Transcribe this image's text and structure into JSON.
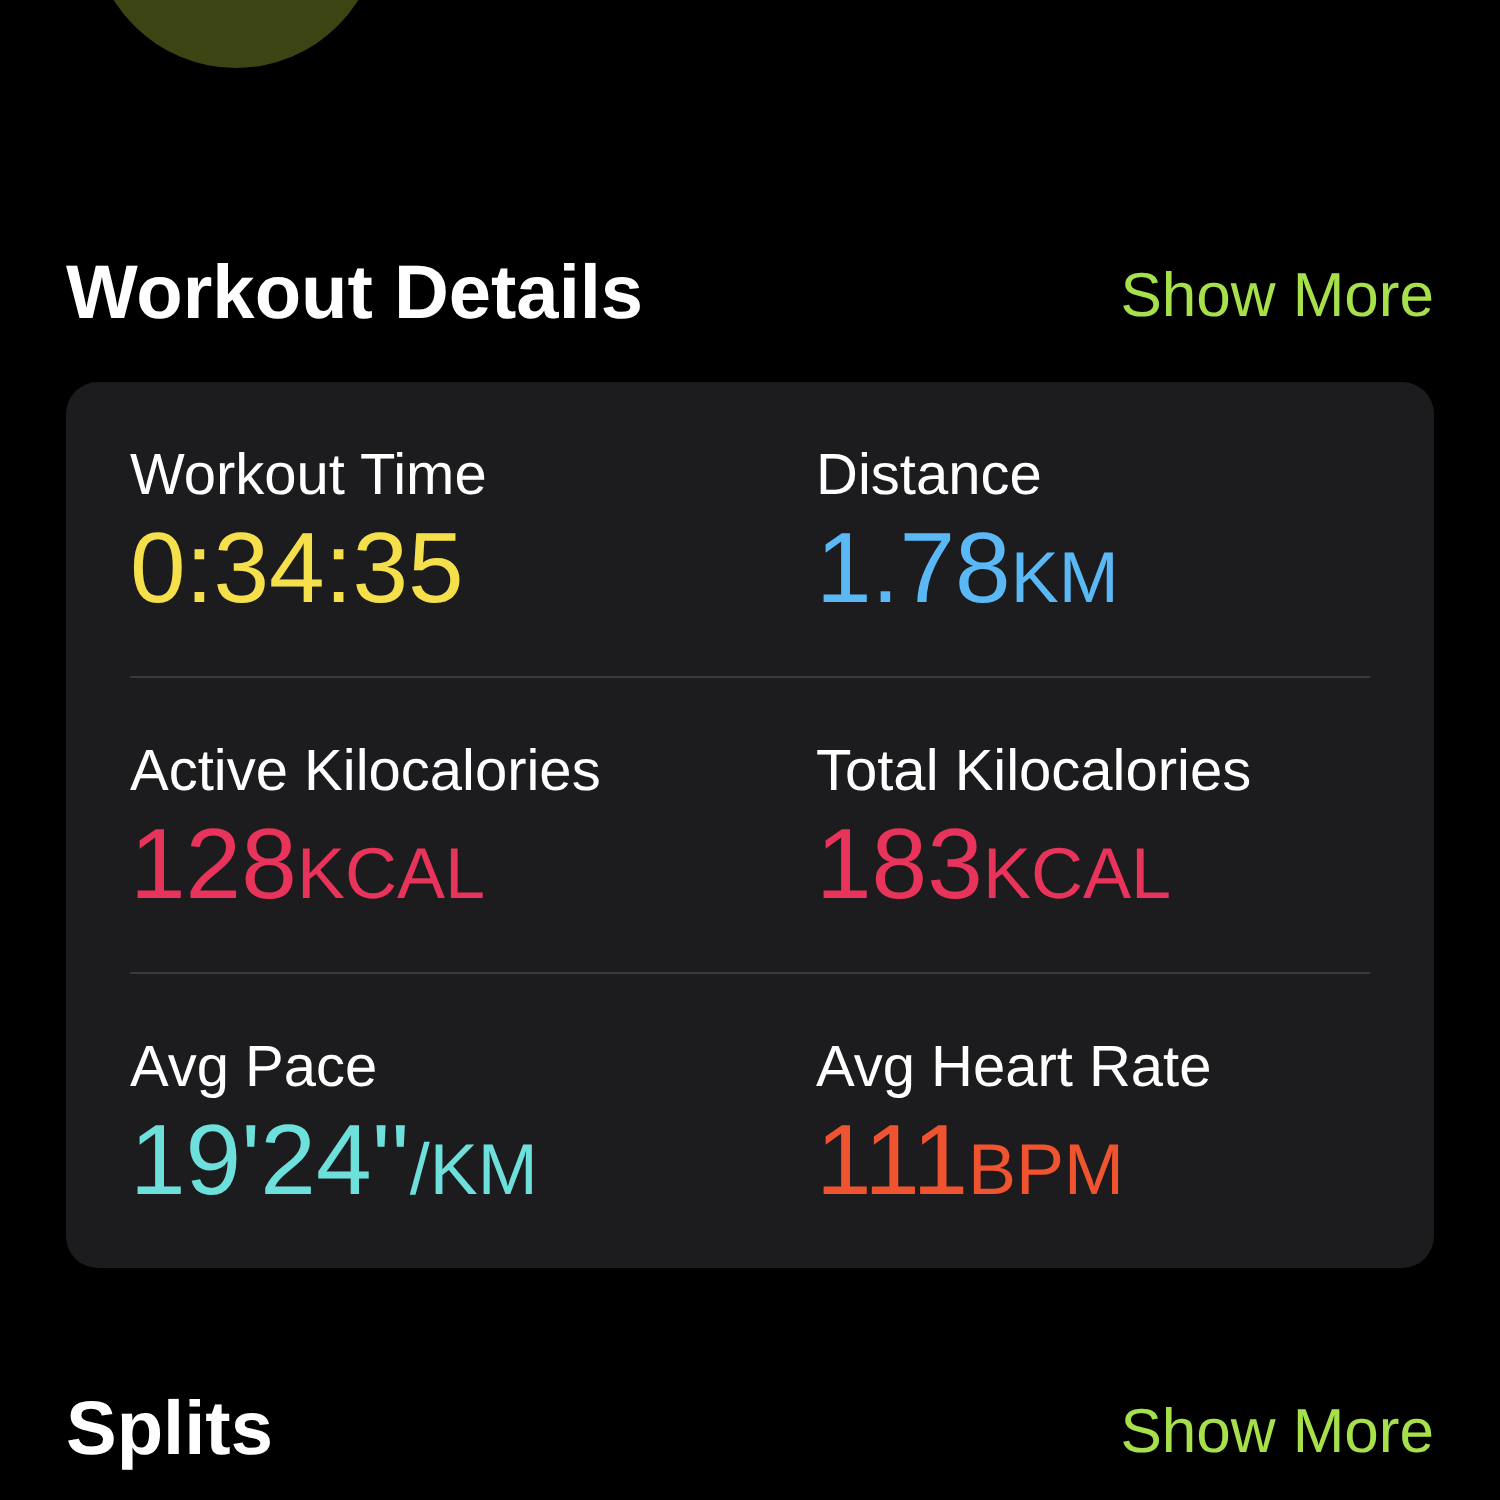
{
  "sections": [
    {
      "title": "Workout Details",
      "action": "Show More",
      "metrics": [
        {
          "label": "Workout Time",
          "value": "0:34:35",
          "color": "#f5e04c"
        },
        {
          "label": "Distance",
          "value": "1.78",
          "unit": "KM",
          "color": "#5ab8f5"
        },
        {
          "label": "Active Kilocalories",
          "value": "128",
          "unit": "KCAL",
          "color": "#e8335a"
        },
        {
          "label": "Total Kilocalories",
          "value": "183",
          "unit": "KCAL",
          "color": "#e8335a"
        },
        {
          "label": "Avg Pace",
          "value": "19'24''",
          "unit": "/KM",
          "color": "#6ee0dc"
        },
        {
          "label": "Avg Heart Rate",
          "value": "111",
          "unit": "BPM",
          "color": "#f0532f"
        }
      ]
    },
    {
      "title": "Splits",
      "action": "Show More"
    }
  ]
}
